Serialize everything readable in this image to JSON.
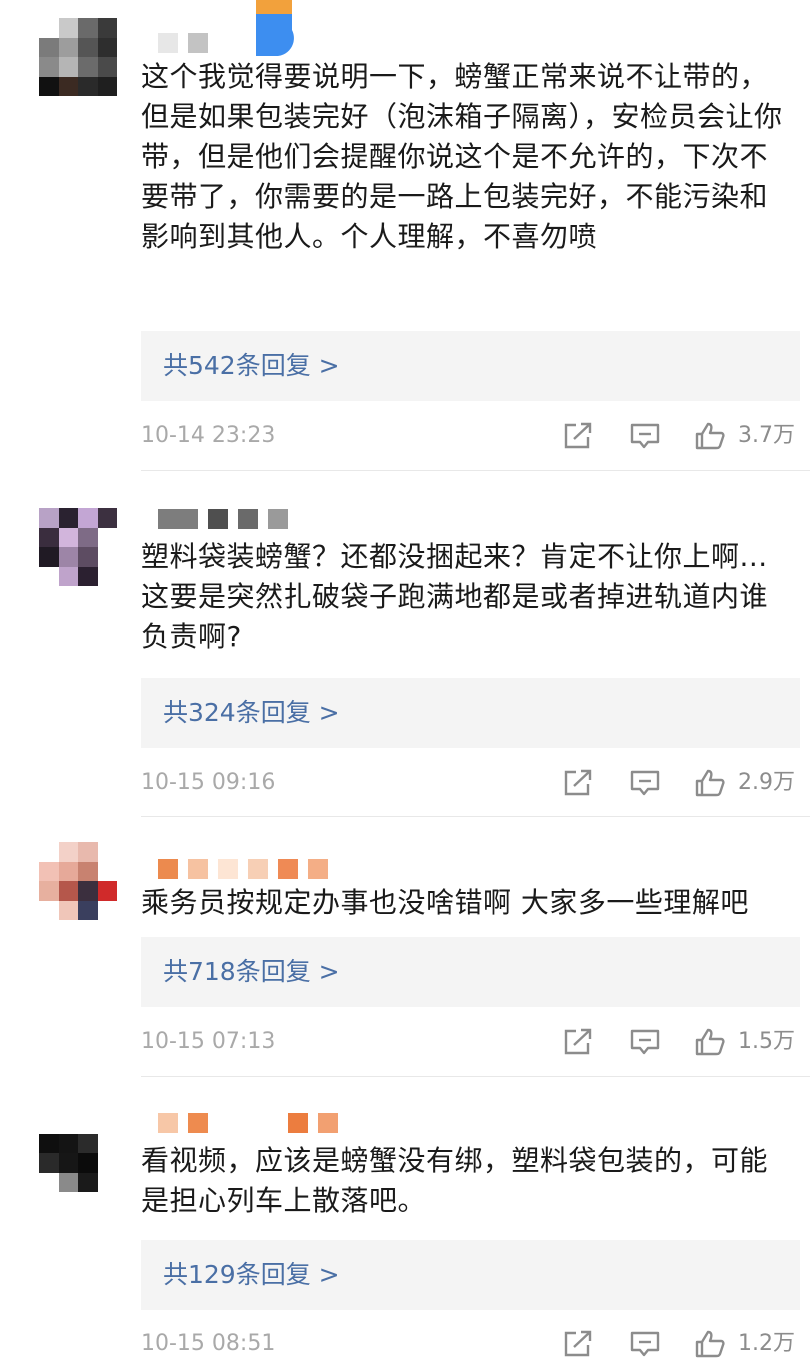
{
  "comments": [
    {
      "text": "这个我觉得要说明一下，螃蟹正常来说不让带的，但是如果包装完好（泡沫箱子隔离），安检员会让你带，但是他们会提醒你说这个是不允许的，下次不要带了，你需要的是一路上包装完好，不能污染和影响到其他人。个人理解，不喜勿喷",
      "replies": "共542条回复 >",
      "time": "10-14 23:23",
      "likes": "3.7万"
    },
    {
      "text": "塑料袋装螃蟹？还都没捆起来？肯定不让你上啊...这要是突然扎破袋子跑满地都是或者掉进轨道内谁负责啊?",
      "replies": "共324条回复 >",
      "time": "10-15 09:16",
      "likes": "2.9万"
    },
    {
      "text": "乘务员按规定办事也没啥错啊 大家多一些理解吧",
      "replies": "共718条回复 >",
      "time": "10-15 07:13",
      "likes": "1.5万"
    },
    {
      "text": "看视频，应该是螃蟹没有绑，塑料袋包装的，可能是担心列车上散落吧。",
      "replies": "共129条回复 >",
      "time": "10-15 08:51",
      "likes": "1.2万"
    }
  ],
  "icons": {
    "share": "share-icon",
    "comment": "comment-icon",
    "like": "thumbs-up-icon"
  },
  "colors": {
    "reply_link": "#4a6fa5",
    "meta_text": "#a9a9a9",
    "reply_bg": "#f4f4f4"
  }
}
